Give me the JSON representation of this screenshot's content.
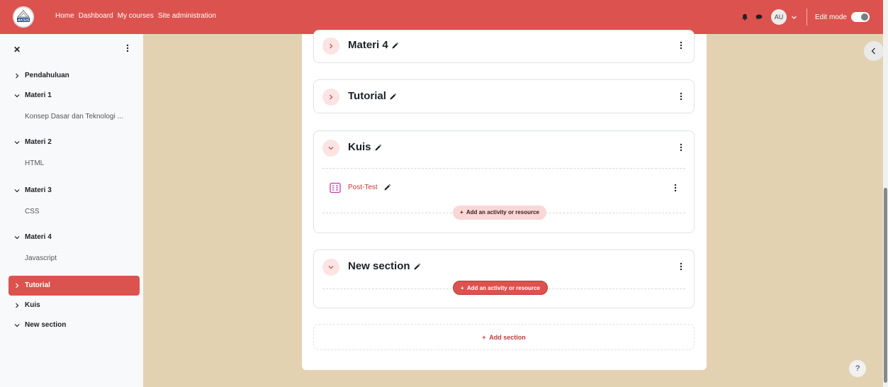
{
  "navbar": {
    "logo_text": "AKSIS",
    "links": [
      "Home",
      "Dashboard",
      "My courses",
      "Site administration"
    ],
    "avatar_initials": "AU",
    "edit_mode_label": "Edit mode",
    "edit_mode_on": false
  },
  "sidebar": {
    "items": [
      {
        "label": "Pendahuluan",
        "type": "section",
        "expanded": false
      },
      {
        "label": "Materi 1",
        "type": "section",
        "expanded": true
      },
      {
        "label": "Konsep Dasar dan Teknologi ...",
        "type": "activity"
      },
      {
        "label": "Materi 2",
        "type": "section",
        "expanded": true
      },
      {
        "label": "HTML",
        "type": "activity"
      },
      {
        "label": "Materi 3",
        "type": "section",
        "expanded": true
      },
      {
        "label": "CSS",
        "type": "activity"
      },
      {
        "label": "Materi 4",
        "type": "section",
        "expanded": true
      },
      {
        "label": "Javascript",
        "type": "activity"
      },
      {
        "label": "Tutorial",
        "type": "section",
        "expanded": false,
        "active": true
      },
      {
        "label": "Kuis",
        "type": "section",
        "expanded": false
      },
      {
        "label": "New section",
        "type": "section",
        "expanded": true
      }
    ]
  },
  "main": {
    "sections": [
      {
        "title": "Materi 4",
        "collapsed": true
      },
      {
        "title": "Tutorial",
        "collapsed": true
      },
      {
        "title": "Kuis",
        "collapsed": false,
        "activities": [
          {
            "name": "Post-Test",
            "icon": "quiz-icon"
          }
        ],
        "add_label": "Add an activity or resource"
      },
      {
        "title": "New section",
        "collapsed": false,
        "add_label": "Add an activity or resource"
      }
    ],
    "add_section_label": "Add section"
  },
  "help_label": "?",
  "colors": {
    "brand": "#dc524e",
    "page_background": "#e3d2b2",
    "chevron_bg": "#fbe4e3"
  }
}
